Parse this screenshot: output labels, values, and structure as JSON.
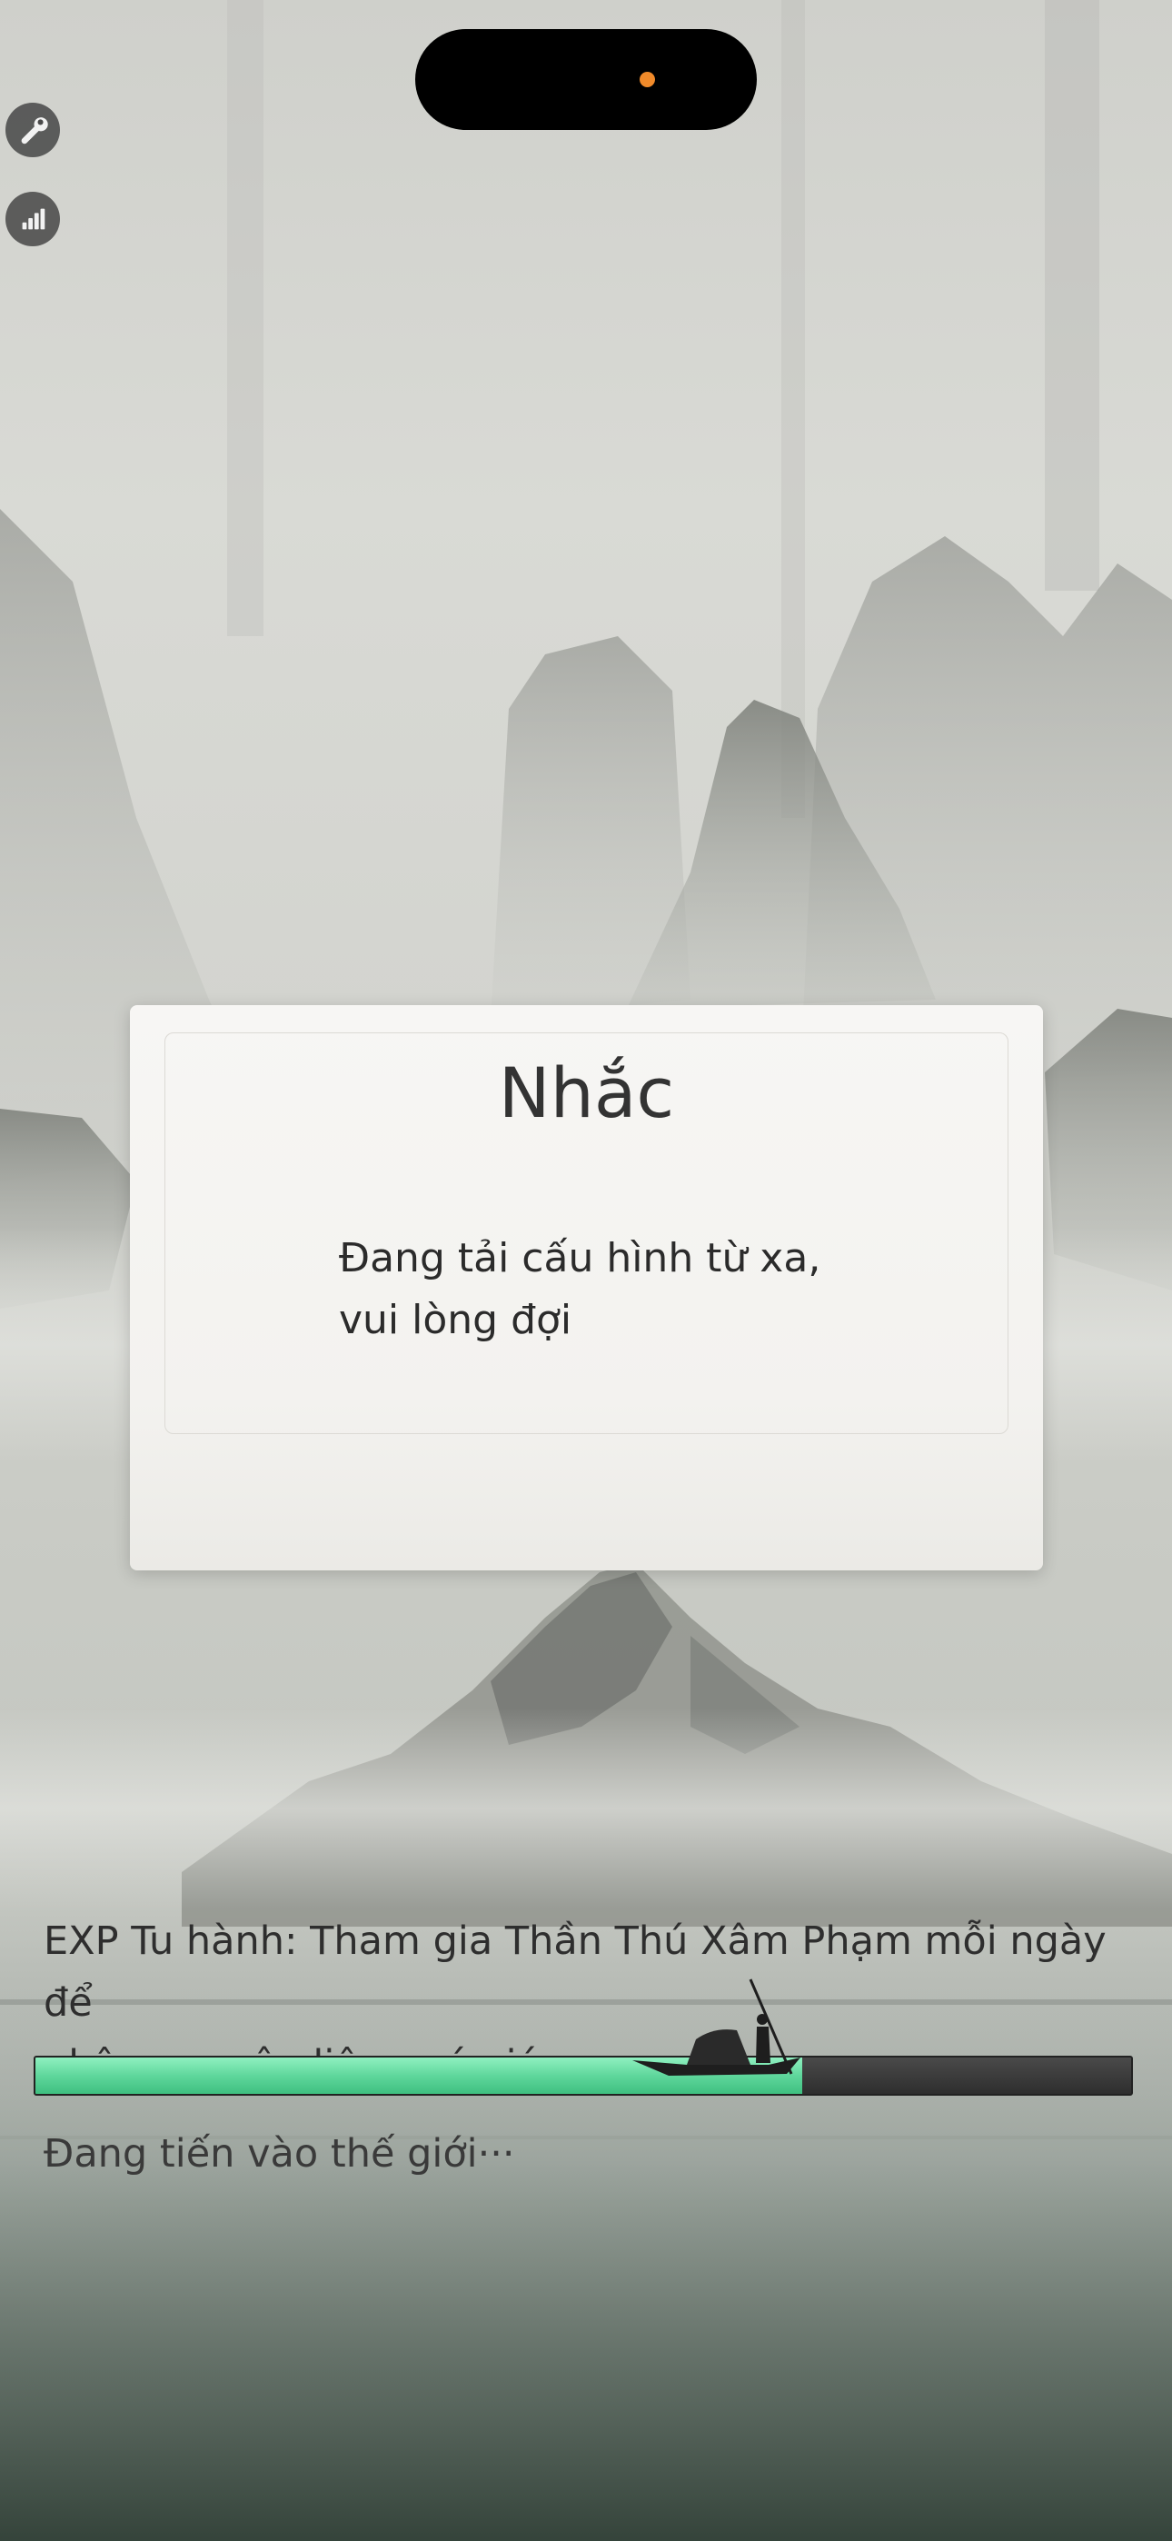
{
  "toolbar": {
    "wrench_icon": "wrench-icon",
    "stats_icon": "signal-bars-icon"
  },
  "dialog": {
    "title": "Nhắc",
    "message_line1": "Đang tải cấu hình từ xa,",
    "message_line2": "vui lòng đợi"
  },
  "loading": {
    "tip_line1": "EXP Tu hành: Tham gia Thần Thú Xâm Phạm mỗi ngày để",
    "tip_line2": "nhận nguyên liệu quý giá.",
    "progress_fraction": 0.7,
    "status_text": "Đang tiến vào thế giới···"
  },
  "colors": {
    "progress_fill": "#5fd79c",
    "progress_track": "#3a3a3a",
    "island_dot": "#f08a2a"
  }
}
